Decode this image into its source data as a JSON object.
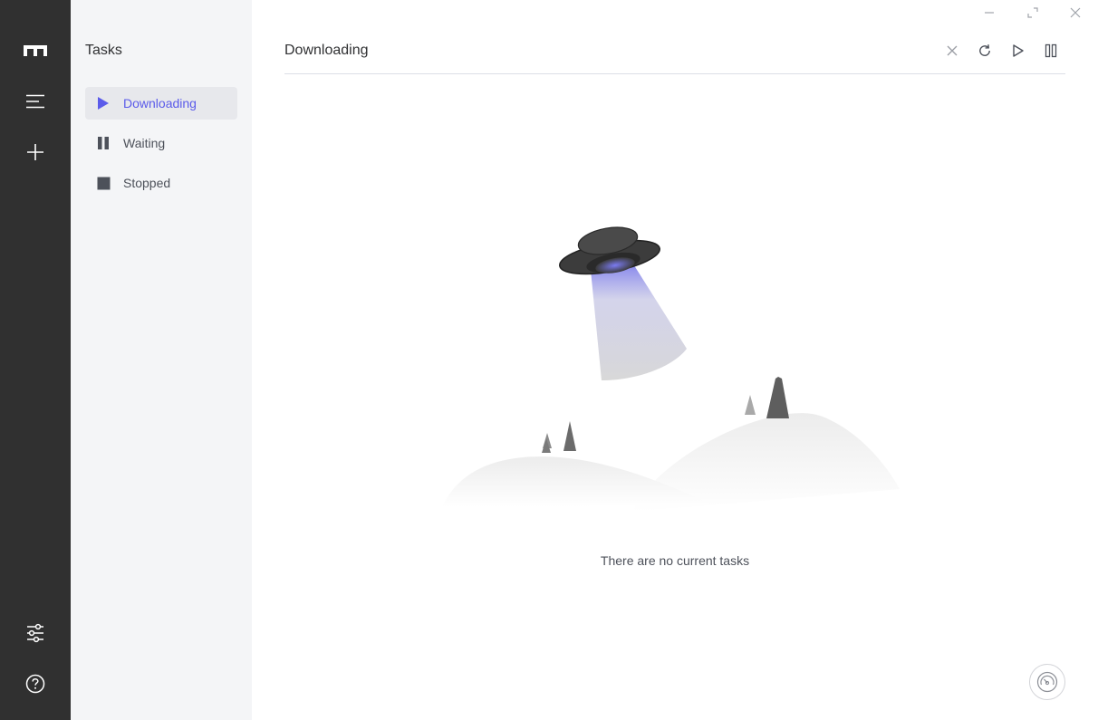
{
  "app": {
    "logo_icon": "motrix-logo-icon",
    "rail": {
      "task_list_icon": "menu-lines-icon",
      "add_task_icon": "plus-icon",
      "preferences_icon": "sliders-icon",
      "help_icon": "question-circle-icon"
    }
  },
  "sidebar": {
    "title": "Tasks",
    "items": [
      {
        "label": "Downloading",
        "icon": "play-icon",
        "active": true
      },
      {
        "label": "Waiting",
        "icon": "pause-icon",
        "active": false
      },
      {
        "label": "Stopped",
        "icon": "stop-icon",
        "active": false
      }
    ]
  },
  "window_controls": {
    "minimize_icon": "minimize-icon",
    "maximize_icon": "maximize-icon",
    "close_icon": "close-icon"
  },
  "main": {
    "title": "Downloading",
    "toolbar": {
      "delete_icon": "close-icon",
      "refresh_icon": "refresh-icon",
      "resume_all_icon": "play-outline-icon",
      "pause_all_icon": "pause-outline-icon"
    },
    "empty_state": {
      "illustration": "ufo-illustration",
      "message": "There are no current tasks"
    },
    "speedometer_icon": "speedometer-icon"
  },
  "colors": {
    "rail_bg": "#303030",
    "sidebar_bg": "#f4f5f7",
    "active_item_bg": "#e7e8ec",
    "accent": "#5b5bea",
    "text": "#303133",
    "muted_text": "#4d515a"
  }
}
